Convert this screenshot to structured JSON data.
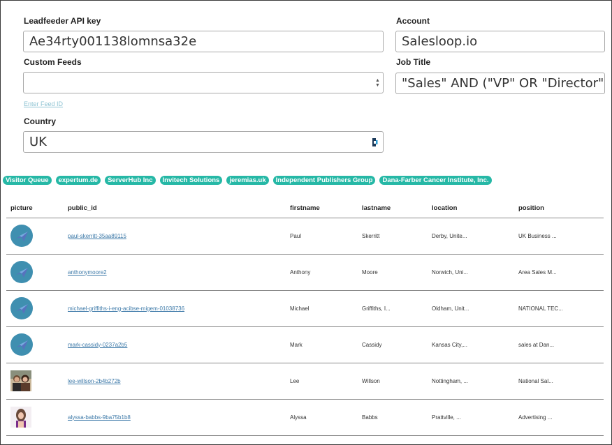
{
  "form": {
    "api_key": {
      "label": "Leadfeeder API key",
      "value": "Ae34rty001138lomnsa32e"
    },
    "account": {
      "label": "Account",
      "value": "Salesloop.io"
    },
    "custom_feeds": {
      "label": "Custom Feeds",
      "value": "",
      "link": "Enter Feed ID"
    },
    "job_title": {
      "label": "Job Title",
      "value": "\"Sales\" AND (\"VP\" OR \"Director\")"
    },
    "country": {
      "label": "Country",
      "value": "UK"
    }
  },
  "tags": [
    "Visitor Queue",
    "expertum.de",
    "ServerHub Inc",
    "Invitech Solutions",
    "jeremias.uk",
    "Independent Publishers Group",
    "Dana-Farber Cancer Institute, Inc."
  ],
  "table": {
    "columns": [
      "picture",
      "public_id",
      "firstname",
      "lastname",
      "location",
      "position"
    ],
    "rows": [
      {
        "avatar": "default-avatar-icon",
        "public_id": "paul-skerritt-35aa89115",
        "firstname": "Paul",
        "lastname": "Skerritt",
        "location": "Derby, Unite...",
        "position": "UK Business ..."
      },
      {
        "avatar": "default-avatar-icon",
        "public_id": "anthonymoore2",
        "firstname": "Anthony",
        "lastname": "Moore",
        "location": "Norwich, Uni...",
        "position": "Area Sales M..."
      },
      {
        "avatar": "default-avatar-icon",
        "public_id": "michael-griffiths-i-eng-acibse-migem-01038736",
        "firstname": "Michael",
        "lastname": "Griffiths, I...",
        "location": "Oldham, Unit...",
        "position": "NATIONAL TEC..."
      },
      {
        "avatar": "default-avatar-icon",
        "public_id": "mark-cassidy-0237a2b5",
        "firstname": "Mark",
        "lastname": "Cassidy",
        "location": "Kansas City,...",
        "position": "sales at Dan..."
      },
      {
        "avatar": "photo-couple",
        "public_id": "lee-willson-2b4b272b",
        "firstname": "Lee",
        "lastname": "Willson",
        "location": "Nottingham, ...",
        "position": "National Sal..."
      },
      {
        "avatar": "photo-woman",
        "public_id": "alyssa-babbs-9ba75b1b8",
        "firstname": "Alyssa",
        "lastname": "Babbs",
        "location": "Prattville, ...",
        "position": "Advertising ..."
      }
    ]
  },
  "colors": {
    "tag_bg": "#26b8a6",
    "link": "#3c79a8",
    "avatar_bg": "#3f8fb0"
  }
}
